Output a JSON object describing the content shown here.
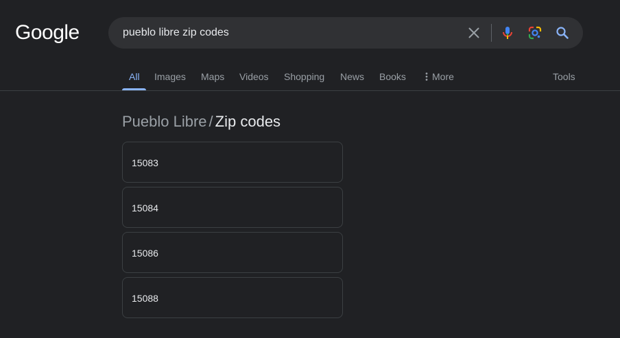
{
  "logo": {
    "text": "Google"
  },
  "search": {
    "query": "pueblo libre zip codes",
    "icons": [
      "clear-icon",
      "microphone-icon",
      "lens-icon",
      "search-icon"
    ]
  },
  "tabs": [
    {
      "label": "All",
      "active": true
    },
    {
      "label": "Images"
    },
    {
      "label": "Maps"
    },
    {
      "label": "Videos"
    },
    {
      "label": "Shopping"
    },
    {
      "label": "News"
    },
    {
      "label": "Books"
    },
    {
      "label": "More",
      "icon": "more-vert-icon"
    }
  ],
  "tools_label": "Tools",
  "breadcrumb": {
    "parent": "Pueblo Libre",
    "separator": "/",
    "current": "Zip codes"
  },
  "zip_codes": [
    "15083",
    "15084",
    "15086",
    "15088"
  ],
  "colors": {
    "background": "#202124",
    "searchbox": "#303134",
    "accent": "#8ab4f8",
    "muted_text": "#9aa0a6",
    "text": "#e8eaed",
    "border": "#3c4043"
  }
}
